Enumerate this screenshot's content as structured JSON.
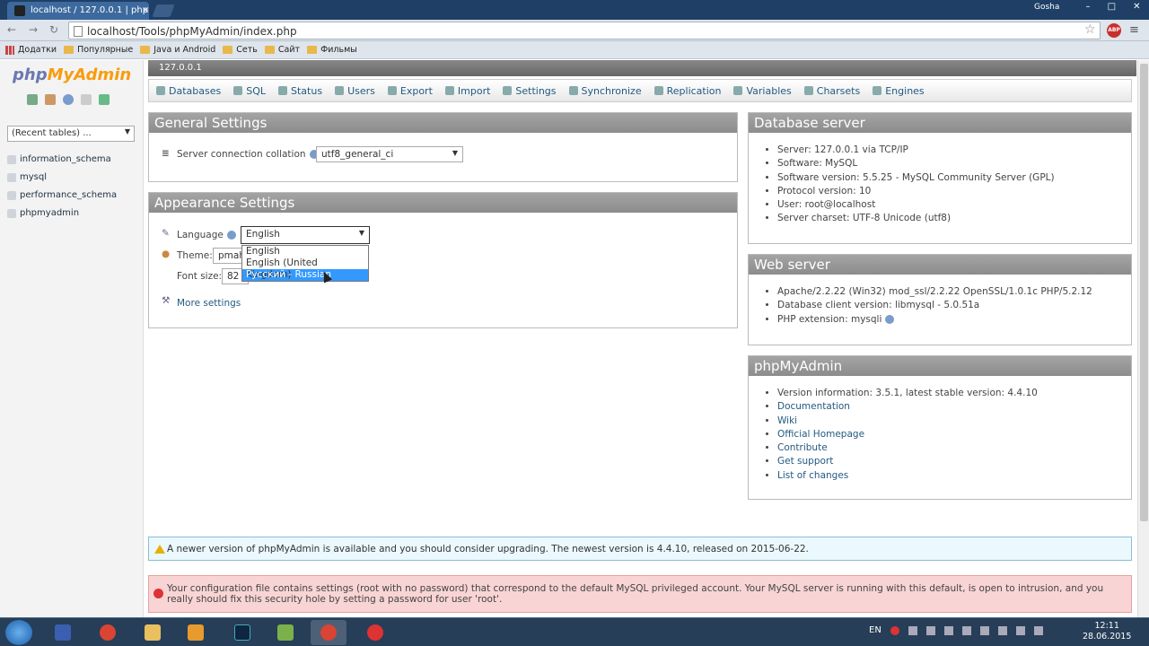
{
  "browser": {
    "tab_title": "localhost / 127.0.0.1 | php",
    "user": "Gosha",
    "url": "localhost/Tools/phpMyAdmin/index.php",
    "bookmarks": [
      "Додатки",
      "Популярные",
      "Java и Android",
      "Сеть",
      "Сайт",
      "Фильмы"
    ]
  },
  "sidebar": {
    "logo_a": "php",
    "logo_b": "MyAdmin",
    "recent": "(Recent tables) ...",
    "databases": [
      "information_schema",
      "mysql",
      "performance_schema",
      "phpmyadmin"
    ]
  },
  "server_bar": "127.0.0.1",
  "tabs": [
    "Databases",
    "SQL",
    "Status",
    "Users",
    "Export",
    "Import",
    "Settings",
    "Synchronize",
    "Replication",
    "Variables",
    "Charsets",
    "Engines"
  ],
  "general": {
    "title": "General Settings",
    "collation_label": "Server connection collation",
    "collation_value": "utf8_general_ci"
  },
  "appearance": {
    "title": "Appearance Settings",
    "language_label": "Language",
    "language_value": "English",
    "theme_label": "Theme:",
    "theme_value": "pmah",
    "fontsize_label": "Font size:",
    "fontsize_value": "82",
    "more_settings": "More settings",
    "options": [
      "English",
      "English (United Kingdom)",
      "Русский - Russian"
    ]
  },
  "db_server": {
    "title": "Database server",
    "items": [
      "Server: 127.0.0.1 via TCP/IP",
      "Software: MySQL",
      "Software version: 5.5.25 - MySQL Community Server (GPL)",
      "Protocol version: 10",
      "User: root@localhost",
      "Server charset: UTF-8 Unicode (utf8)"
    ]
  },
  "web_server": {
    "title": "Web server",
    "items": [
      "Apache/2.2.22 (Win32) mod_ssl/2.2.22 OpenSSL/1.0.1c PHP/5.2.12",
      "Database client version: libmysql - 5.0.51a",
      "PHP extension: mysqli"
    ]
  },
  "pma": {
    "title": "phpMyAdmin",
    "version": "Version information: 3.5.1, latest stable version: 4.4.10",
    "links": [
      "Documentation",
      "Wiki",
      "Official Homepage",
      "Contribute",
      "Get support",
      "List of changes"
    ]
  },
  "notice": "A newer version of phpMyAdmin is available and you should consider upgrading. The newest version is 4.4.10, released on 2015-06-22.",
  "error": "Your configuration file contains settings (root with no password) that correspond to the default MySQL privileged account. Your MySQL server is running with this default, is open to intrusion, and you really should fix this security hole by setting a password for user 'root'.",
  "taskbar": {
    "lang": "EN",
    "time": "12:11",
    "date": "28.06.2015"
  },
  "colors": {
    "accent": "#235a81",
    "notice_bg": "#ebf8fd",
    "error_bg": "#f8d4d4"
  }
}
